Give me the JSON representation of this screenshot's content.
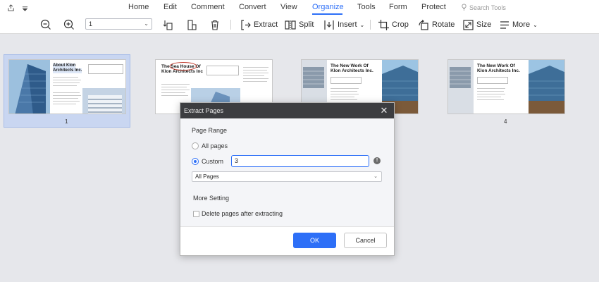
{
  "menubar": {
    "items": [
      {
        "label": "Home"
      },
      {
        "label": "Edit"
      },
      {
        "label": "Comment"
      },
      {
        "label": "Convert"
      },
      {
        "label": "View"
      },
      {
        "label": "Organize"
      },
      {
        "label": "Tools"
      },
      {
        "label": "Form"
      },
      {
        "label": "Protect"
      }
    ],
    "active_item": "Organize",
    "search_placeholder": "Search Tools"
  },
  "toolbar": {
    "page_select_value": "1",
    "extract_label": "Extract",
    "split_label": "Split",
    "insert_label": "Insert",
    "crop_label": "Crop",
    "rotate_label": "Rotate",
    "size_label": "Size",
    "more_label": "More"
  },
  "pages": [
    {
      "number": "1",
      "title_line1": "About Klon",
      "title_line2": "Architects Inc.",
      "selected": true
    },
    {
      "number": "",
      "title_line1": "The Sea House Of",
      "title_line2": "Klon Architects Inc",
      "selected": false
    },
    {
      "number": "",
      "title_line1": "The New Work Of",
      "title_line2": "Klon Architects Inc.",
      "selected": false
    },
    {
      "number": "4",
      "title_line1": "The New Work Of",
      "title_line2": "Klon Architects Inc.",
      "selected": false
    }
  ],
  "dialog": {
    "title": "Extract Pages",
    "page_range_heading": "Page Range",
    "all_pages_label": "All pages",
    "custom_label": "Custom",
    "custom_value": "3",
    "subset_select_value": "All Pages",
    "more_setting_heading": "More Setting",
    "delete_checkbox_label": "Delete pages after extracting",
    "ok_label": "OK",
    "cancel_label": "Cancel"
  },
  "colors": {
    "accent": "#2d6ff7",
    "dialog_titlebar": "#3c3d40",
    "canvas": "#e6e7eb",
    "selection": "#c9d6f1"
  }
}
